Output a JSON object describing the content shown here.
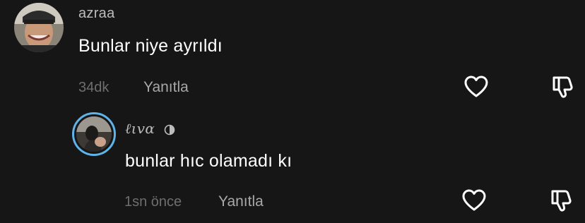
{
  "comments": [
    {
      "username": "azraa",
      "text": "Bunlar niye ayrıldı",
      "time": "34dk",
      "reply_label": "Yanıtla"
    }
  ],
  "replies": [
    {
      "username": "ℓιvα",
      "text": "bunlar hıc olamadı kı",
      "time": "1sn önce",
      "reply_label": "Yanıtla",
      "story_ring_color": "#5fb3e8"
    }
  ],
  "icons": {
    "like": "heart-outline-icon",
    "dislike": "thumbs-down-icon",
    "badge": "half-moon-icon"
  },
  "colors": {
    "background": "#161617",
    "text_primary": "#ffffff",
    "text_secondary": "#a8a8a8",
    "text_muted": "#6e6e6e"
  }
}
